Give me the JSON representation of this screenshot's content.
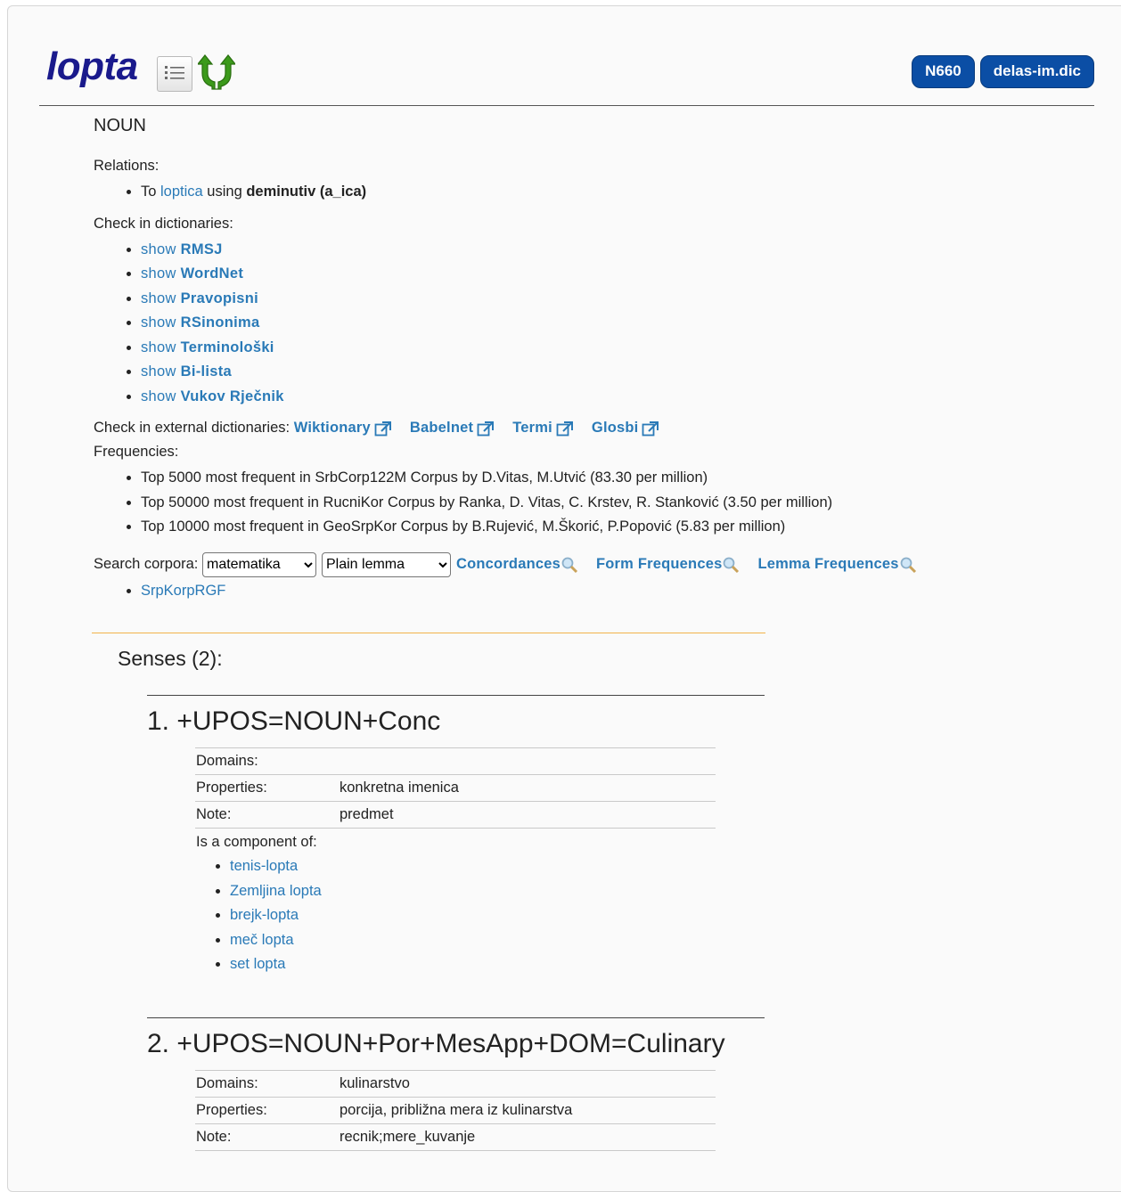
{
  "lemma": "lopta",
  "badges": [
    "N660",
    "delas-im.dic"
  ],
  "pos": "NOUN",
  "relations": {
    "label": "Relations:",
    "items": [
      {
        "to_prefix": "To ",
        "target": "loptica",
        "using": " using ",
        "rel": "deminutiv (a_ica)"
      }
    ]
  },
  "dictionaries": {
    "label": "Check in dictionaries:",
    "show": "show",
    "items": [
      "RMSJ",
      "WordNet",
      "Pravopisni",
      "RSinonima",
      "Terminološki",
      "Bi-lista",
      "Vukov Rječnik"
    ]
  },
  "external": {
    "label": "Check in external dictionaries: ",
    "links": [
      "Wiktionary",
      "Babelnet",
      "Termi",
      "Glosbi"
    ]
  },
  "frequencies": {
    "label": "Frequencies:",
    "items": [
      "Top 5000 most frequent in SrbCorp122M Corpus by D.Vitas, M.Utvić (83.30 per million)",
      "Top 50000 most frequent in RucniKor Corpus by Ranka, D. Vitas, C. Krstev, R. Stanković (3.50 per million)",
      "Top 10000 most frequent in GeoSrpKor Corpus by B.Rujević, M.Škorić, P.Popović (5.83 per million)"
    ]
  },
  "search": {
    "label": "Search corpora: ",
    "corpus_selected": "matematika",
    "mode_selected": "Plain lemma",
    "links": [
      "Concordances",
      "Form Frequences",
      "Lemma Frequences"
    ],
    "corpora": [
      "SrpKorpRGF"
    ]
  },
  "senses_title": "Senses (2):",
  "senses": [
    {
      "heading": "1. +UPOS=NOUN+Conc",
      "rows": [
        {
          "k": "Domains:",
          "v": ""
        },
        {
          "k": "Properties:",
          "v": "konkretna imenica"
        },
        {
          "k": "Note:",
          "v": "predmet"
        }
      ],
      "component_label": "Is a component of:",
      "components": [
        "tenis-lopta",
        "Zemljina lopta",
        "brejk-lopta",
        "meč lopta",
        "set lopta"
      ]
    },
    {
      "heading": "2. +UPOS=NOUN+Por+MesApp+DOM=Culinary",
      "rows": [
        {
          "k": "Domains:",
          "v": "kulinarstvo"
        },
        {
          "k": "Properties:",
          "v": "porcija, približna mera iz kulinarstva"
        },
        {
          "k": "Note:",
          "v": "recnik;mere_kuvanje"
        }
      ]
    }
  ],
  "icons": {
    "list": "list-icon",
    "updown": "green-arrows-icon",
    "external": "external-link-icon",
    "search": "magnifier-icon"
  },
  "colors": {
    "title": "#1a1a8c",
    "badge": "#0b4ea5",
    "link": "#2a7ab7",
    "orange_rule": "#f2b24a"
  }
}
